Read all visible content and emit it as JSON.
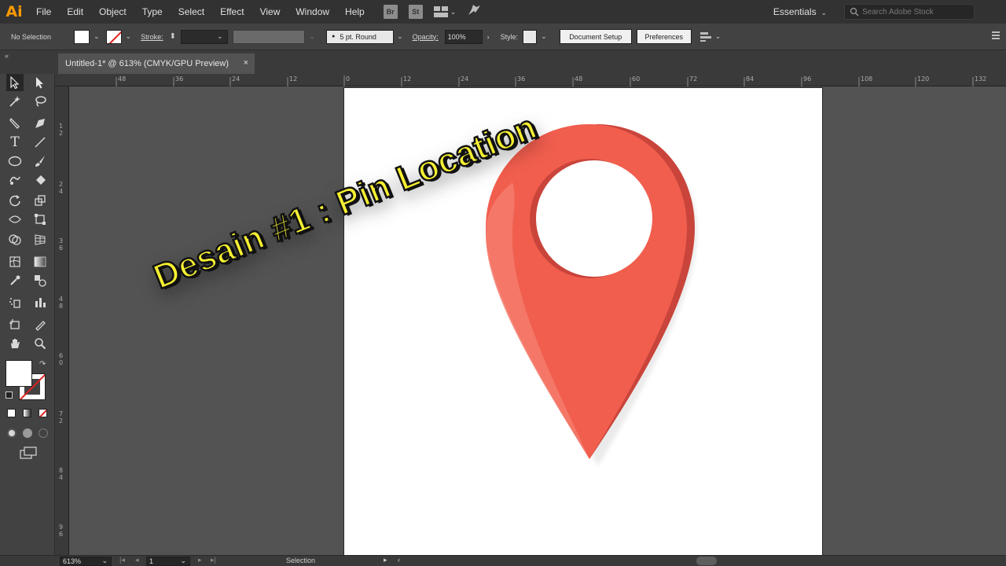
{
  "app": {
    "logo": "Ai"
  },
  "menu": [
    "File",
    "Edit",
    "Object",
    "Type",
    "Select",
    "Effect",
    "View",
    "Window",
    "Help"
  ],
  "menu_badges": {
    "bridge": "Br",
    "stock": "St"
  },
  "workspace": {
    "label": "Essentials",
    "search_placeholder": "Search Adobe Stock"
  },
  "controlbar": {
    "selection": "No Selection",
    "stroke_label": "Stroke:",
    "brush": "5 pt. Round",
    "opacity_label": "Opacity:",
    "opacity_value": "100%",
    "style_label": "Style:",
    "document_setup": "Document Setup",
    "preferences": "Preferences"
  },
  "tab": {
    "title": "Untitled-1* @ 613% (CMYK/GPU Preview)",
    "close": "×"
  },
  "ruler_h": [
    "48",
    "36",
    "24",
    "12",
    "0",
    "12",
    "24",
    "36",
    "48",
    "60",
    "72",
    "84",
    "96",
    "108",
    "120",
    "132"
  ],
  "ruler_v": [
    "1\n2",
    "2\n4",
    "3\n6",
    "4\n8",
    "6\n0",
    "7\n2",
    "8\n4",
    "9\n6"
  ],
  "overlay": {
    "title": "Desain #1 : Pin Location",
    "text_color": "#f6f032"
  },
  "pin": {
    "color": "#f15e4e",
    "shade_color": "#c9443a",
    "highlight_color": "#f47b6d"
  },
  "statusbar": {
    "zoom": "613%",
    "page": "1",
    "tool": "Selection"
  }
}
